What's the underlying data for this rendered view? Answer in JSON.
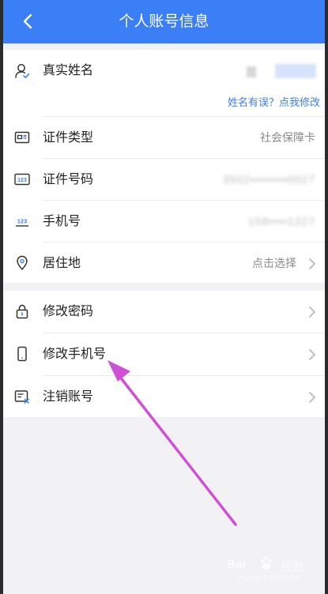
{
  "header": {
    "title": "个人账号信息"
  },
  "profile": {
    "name_label": "真实姓名",
    "name_edit_link": "姓名有误？点我修改",
    "rows": [
      {
        "label": "证件类型",
        "value": "社会保障卡"
      },
      {
        "label": "证件号码",
        "value": "3502••••••••0027"
      },
      {
        "label": "手机号",
        "value": "158••••1227"
      },
      {
        "label": "居住地",
        "value": "点击选择"
      }
    ]
  },
  "security": {
    "items": [
      {
        "label": "修改密码"
      },
      {
        "label": "修改手机号"
      },
      {
        "label": "注销账号"
      }
    ]
  },
  "watermark": {
    "brand": "Bai",
    "suffix": "经验",
    "url": "jingyan.baidu.com"
  },
  "colors": {
    "header": "#3b7ff6",
    "link": "#3b7ff6",
    "annotation_arrow": "#d04fd6"
  }
}
